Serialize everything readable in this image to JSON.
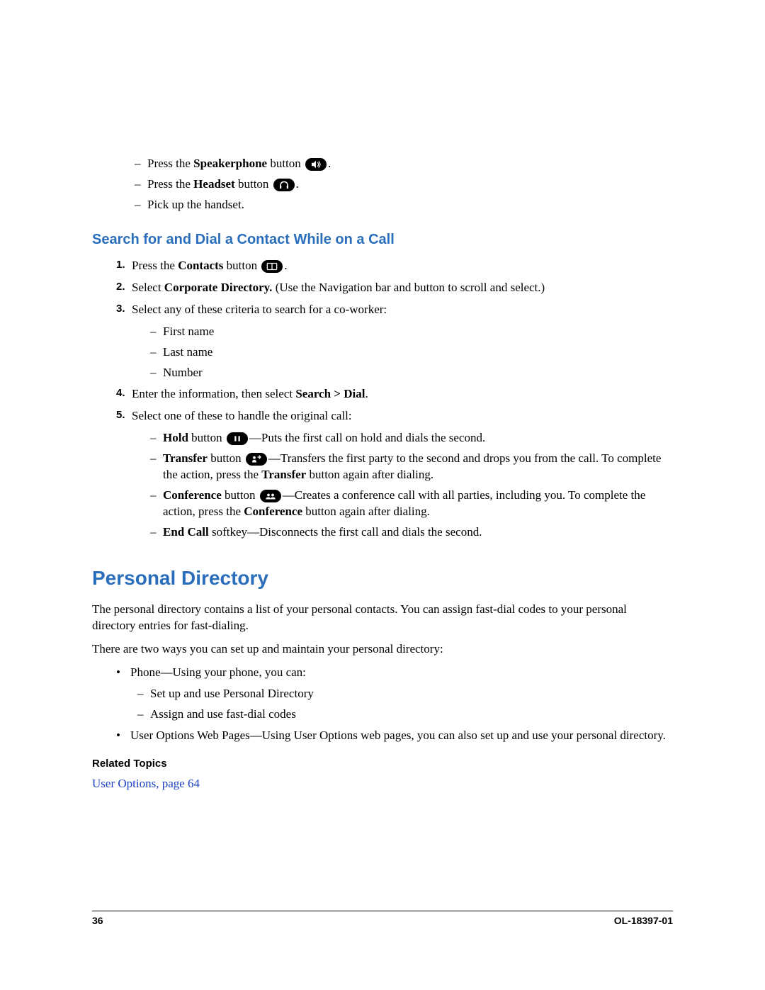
{
  "intro_items": {
    "speakerphone_prefix": "Press the ",
    "speakerphone_bold": "Speakerphone",
    "speakerphone_suffix": " button ",
    "headset_prefix": "Press the ",
    "headset_bold": "Headset",
    "headset_suffix": " button ",
    "handset": "Pick up the handset."
  },
  "search_section": {
    "heading": "Search for and Dial a Contact While on a Call",
    "step1_prefix": "Press the ",
    "step1_bold": "Contacts",
    "step1_suffix": " button ",
    "step2_prefix": "Select ",
    "step2_bold": "Corporate Directory.",
    "step2_suffix": " (Use the Navigation bar and button to scroll and select.)",
    "step3": "Select any of these criteria to search for a co-worker:",
    "step3_items": {
      "a": "First name",
      "b": "Last name",
      "c": "Number"
    },
    "step4_prefix": "Enter the information, then select ",
    "step4_bold": "Search > Dial",
    "step4_suffix": ".",
    "step5": "Select one of these to handle the original call:",
    "step5_items": {
      "hold_bold": "Hold",
      "hold_mid": " button ",
      "hold_suffix": "—Puts the first call on hold and dials the second.",
      "transfer_bold": "Transfer",
      "transfer_mid": " button ",
      "transfer_suffix1": "—Transfers the first party to the second and drops you from the call. To complete the action, press the ",
      "transfer_bold2": "Transfer",
      "transfer_suffix2": " button again after dialing.",
      "conference_bold": "Conference",
      "conference_mid": " button ",
      "conference_suffix1": "—Creates a conference call with all parties, including you. To complete the action, press the ",
      "conference_bold2": "Conference",
      "conference_suffix2": " button again after dialing.",
      "endcall_bold": "End Call",
      "endcall_suffix": " softkey—Disconnects the first call and dials the second."
    }
  },
  "personal": {
    "heading": "Personal Directory",
    "p1": "The personal directory contains a list of your personal contacts. You can assign fast-dial codes to your personal directory entries for fast-dialing.",
    "p2": "There are two ways you can set up and maintain your personal directory:",
    "phone_intro": "Phone—Using your phone, you can:",
    "phone_a": "Set up and use Personal Directory",
    "phone_b": "Assign and use fast-dial codes",
    "web": "User Options Web Pages—Using User Options web pages, you can also set up and use your personal directory.",
    "related_heading": "Related Topics",
    "related_link": "User Options, page 64"
  },
  "footer": {
    "page": "36",
    "docid": "OL-18397-01"
  }
}
